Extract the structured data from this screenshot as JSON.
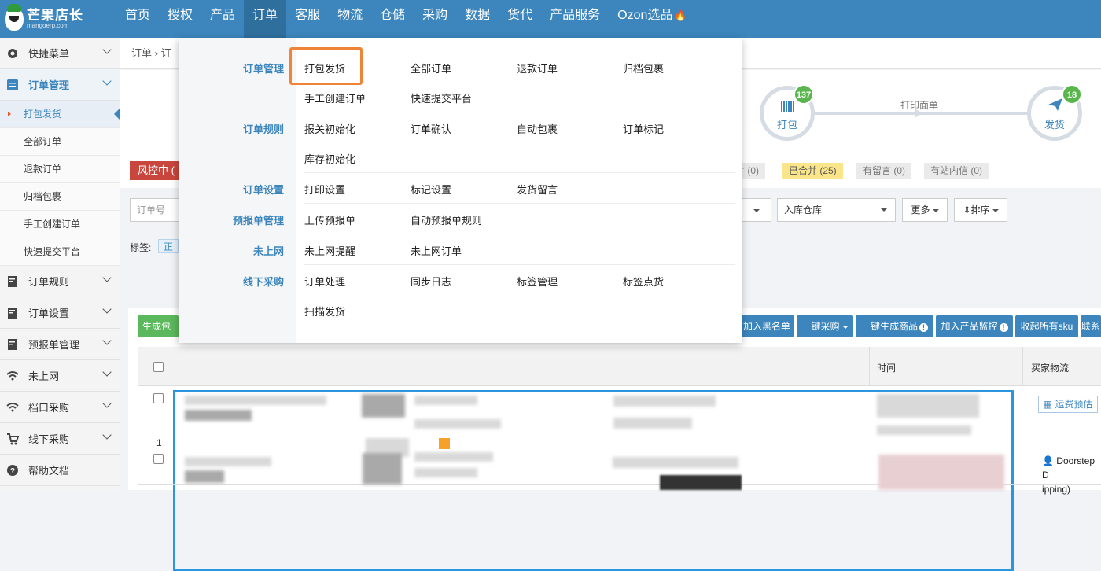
{
  "brand": {
    "name": "芒果店长",
    "domain": "mangoerp.com"
  },
  "nav": [
    "首页",
    "授权",
    "产品",
    "订单",
    "客服",
    "物流",
    "仓储",
    "采购",
    "数据",
    "货代",
    "产品服务",
    "Ozon选品"
  ],
  "sidebar": {
    "quick": "快捷菜单",
    "order_mgmt": "订单管理",
    "subs": [
      "打包发货",
      "全部订单",
      "退款订单",
      "归档包裹",
      "手工创建订单",
      "快速提交平台"
    ],
    "groups": [
      "订单规则",
      "订单设置",
      "预报单管理",
      "未上网",
      "档口采购",
      "线下采购",
      "帮助文档"
    ]
  },
  "breadcrumb": "订单 › 订",
  "flow": {
    "pack_label": "打包",
    "pack_count": "137",
    "print_label": "打印面单",
    "ship_label": "发货",
    "ship_count": "18"
  },
  "tags": {
    "risk": "风控中 (",
    "t1": "件 (0)",
    "merged": "已合并 (25)",
    "msg": "有留言 (0)",
    "site": "有站内信 (0)"
  },
  "filters": {
    "order_no": "订单号",
    "warehouse": "入库仓库",
    "more": "更多",
    "sort": "排序"
  },
  "label_row": {
    "label": "标签:",
    "tag": "正"
  },
  "actions": {
    "gen": "生成包裹",
    "blacklist": "加入黑名单",
    "purchase": "一键采购",
    "gen_product": "一键生成商品",
    "monitor": "加入产品监控",
    "collapse": "收起所有sku",
    "contact": "联系"
  },
  "table": {
    "time": "时间",
    "logistics": "买家物流",
    "row1_index": "1",
    "freight": "运费预估",
    "row2_logistics": "Doorstep D",
    "row2_logistics2": "ipping)"
  },
  "dropdown": {
    "categories": [
      "订单管理",
      "订单规则",
      "订单设置",
      "预报单管理",
      "未上网",
      "线下采购"
    ],
    "order_mgmt": [
      "打包发货",
      "全部订单",
      "退款订单",
      "归档包裹",
      "手工创建订单",
      "快速提交平台"
    ],
    "order_rules": [
      "报关初始化",
      "订单确认",
      "自动包裹",
      "订单标记",
      "库存初始化"
    ],
    "order_settings": [
      "打印设置",
      "标记设置",
      "发货留言"
    ],
    "prealert": [
      "上传预报单",
      "自动预报单规则"
    ],
    "not_online": [
      "未上网提醒",
      "未上网订单"
    ],
    "offline": [
      "订单处理",
      "同步日志",
      "标签管理",
      "标签点货",
      "扫描发货"
    ]
  }
}
